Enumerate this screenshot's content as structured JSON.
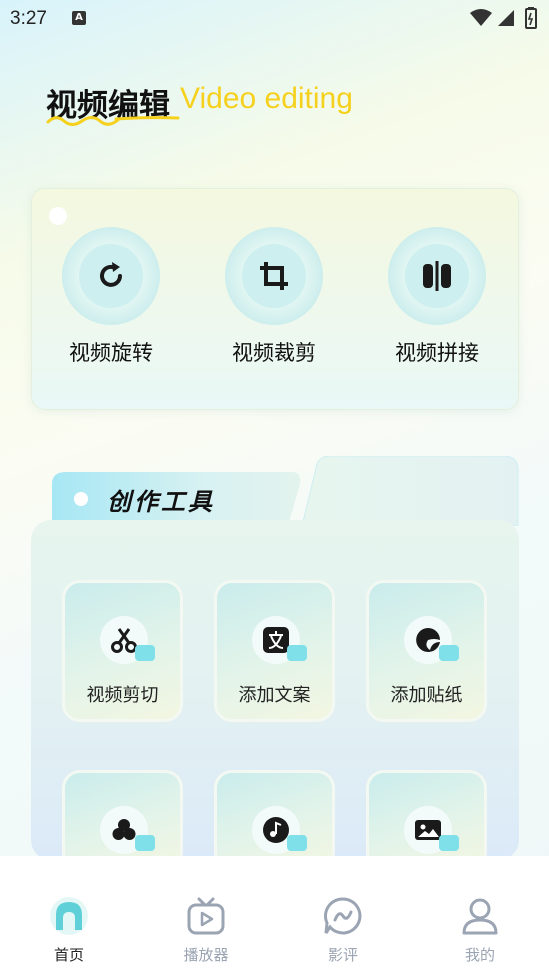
{
  "status": {
    "time": "3:27",
    "notif_icon": "A"
  },
  "hero": {
    "title_zh": "视频编辑",
    "title_en": "Video editing"
  },
  "features": [
    {
      "label": "视频旋转",
      "icon": "rotate-icon"
    },
    {
      "label": "视频裁剪",
      "icon": "crop-icon"
    },
    {
      "label": "视频拼接",
      "icon": "merge-icon"
    }
  ],
  "tools": {
    "title": "创作工具",
    "items": [
      {
        "label": "视频剪切",
        "icon": "scissors-icon"
      },
      {
        "label": "添加文案",
        "icon": "text-icon"
      },
      {
        "label": "添加贴纸",
        "icon": "sticker-icon"
      },
      {
        "label": "",
        "icon": "filter-icon"
      },
      {
        "label": "",
        "icon": "music-icon"
      },
      {
        "label": "",
        "icon": "image-icon"
      }
    ]
  },
  "nav": {
    "items": [
      {
        "label": "首页",
        "icon": "home-icon",
        "active": true
      },
      {
        "label": "播放器",
        "icon": "player-icon",
        "active": false
      },
      {
        "label": "影评",
        "icon": "review-icon",
        "active": false
      },
      {
        "label": "我的",
        "icon": "profile-icon",
        "active": false
      }
    ]
  },
  "colors": {
    "accent": "#f5d11e",
    "teal": "#7fe0ea",
    "nav_active": "#5fd0d8"
  }
}
